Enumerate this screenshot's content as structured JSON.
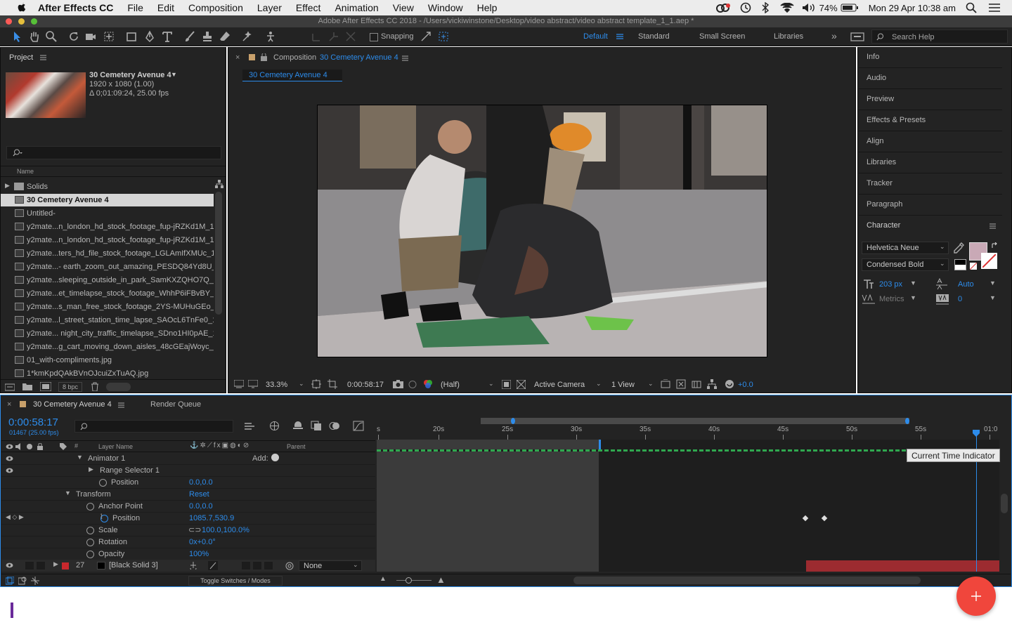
{
  "menubar": {
    "app_name": "After Effects CC",
    "items": [
      "File",
      "Edit",
      "Composition",
      "Layer",
      "Effect",
      "Animation",
      "View",
      "Window",
      "Help"
    ],
    "battery": "74%",
    "datetime": "Mon 29 Apr  10:38 am"
  },
  "window": {
    "title": "Adobe After Effects CC 2018 - /Users/vickiwinstone/Desktop/video abstract/video abstract template_1_1.aep *"
  },
  "toolbar": {
    "snapping": "Snapping",
    "workspaces": [
      "Default",
      "Standard",
      "Small Screen",
      "Libraries"
    ],
    "search_help": "Search Help"
  },
  "project": {
    "title": "Project",
    "comp_name": "30 Cemetery Avenue 4",
    "comp_res": "1920 x 1080 (1.00)",
    "comp_dur": "Δ 0;01:09:24, 25.00 fps",
    "search_placeholder": "",
    "name_col": "Name",
    "items": [
      {
        "name": "Solids",
        "type": "folder"
      },
      {
        "name": "30 Cemetery Avenue 4",
        "type": "comp"
      },
      {
        "name": "Untitled-",
        "type": "comp"
      },
      {
        "name": "y2mate...n_london_hd_stock_footage_fup-jRZKd1M_1",
        "type": "file"
      },
      {
        "name": "y2mate...n_london_hd_stock_footage_fup-jRZKd1M_1",
        "type": "file"
      },
      {
        "name": "y2mate...ters_hd_file_stock_footage_LGLAmIfXMUc_1",
        "type": "file"
      },
      {
        "name": "y2mate...- earth_zoom_out_amazing_PESDQ84Yd8U_",
        "type": "file"
      },
      {
        "name": "y2mate...sleeping_outside_in_park_SamKXZQHO7Q_1",
        "type": "file"
      },
      {
        "name": "y2mate...et_timelapse_stock_footage_WhhP6iFBvBY_1",
        "type": "file"
      },
      {
        "name": "y2mate...s_man_free_stock_footage_2YS-MUHuGEo_1",
        "type": "file"
      },
      {
        "name": "y2mate...l_street_station_time_lapse_SAOcL6TnFe0_1",
        "type": "file"
      },
      {
        "name": "y2mate... night_city_traffic_timelapse_SDno1HI0pAE_1",
        "type": "file"
      },
      {
        "name": "y2mate...g_cart_moving_down_aisles_48cGEajWoyc_1",
        "type": "file"
      },
      {
        "name": "01_with-compliments.jpg",
        "type": "file"
      },
      {
        "name": "1*kmKpdQAkBVnOJcuiZxTuAQ.jpg",
        "type": "file"
      }
    ],
    "bpc": "8 bpc"
  },
  "composition": {
    "header_label": "Composition",
    "header_name": "30 Cemetery Avenue 4",
    "tab": "30 Cemetery Avenue 4",
    "zoom": "33.3%",
    "timecode": "0:00:58:17",
    "resolution": "(Half)",
    "camera": "Active Camera",
    "views": "1 View",
    "exposure": "+0.0"
  },
  "right_panels": [
    "Info",
    "Audio",
    "Preview",
    "Effects & Presets",
    "Align",
    "Libraries",
    "Tracker",
    "Paragraph"
  ],
  "character": {
    "title": "Character",
    "font": "Helvetica Neue",
    "style": "Condensed Bold",
    "size": "203 px",
    "leading": "Auto",
    "kerning": "Metrics",
    "tracking": "0",
    "fill_color": "#c9a9b6"
  },
  "timeline": {
    "tab": "30 Cemetery Avenue 4",
    "render_queue": "Render Queue",
    "timecode": "0:00:58:17",
    "frames": "01467 (25.00 fps)",
    "col_layer_name": "Layer Name",
    "col_parent": "Parent",
    "ruler": [
      "s",
      "20s",
      "25s",
      "30s",
      "35s",
      "40s",
      "45s",
      "50s",
      "55s",
      "01:0"
    ],
    "tooltip": "Current Time Indicator",
    "add_label": "Add:",
    "rows": [
      {
        "label": "Animator 1",
        "value": ""
      },
      {
        "label": "Range Selector 1",
        "value": ""
      },
      {
        "label": "Position",
        "value": "0.0,0.0"
      },
      {
        "label": "Transform",
        "value": "Reset"
      },
      {
        "label": "Anchor Point",
        "value": "0.0,0.0"
      },
      {
        "label": "Position",
        "value": "1085.7,530.9"
      },
      {
        "label": "Scale",
        "value": "100.0,100.0%"
      },
      {
        "label": "Rotation",
        "value": "0x+0.0°"
      },
      {
        "label": "Opacity",
        "value": "100%"
      }
    ],
    "layer_num": "27",
    "layer_name": "[Black Solid 3]",
    "parent_value": "None",
    "toggle_label": "Toggle Switches / Modes"
  }
}
